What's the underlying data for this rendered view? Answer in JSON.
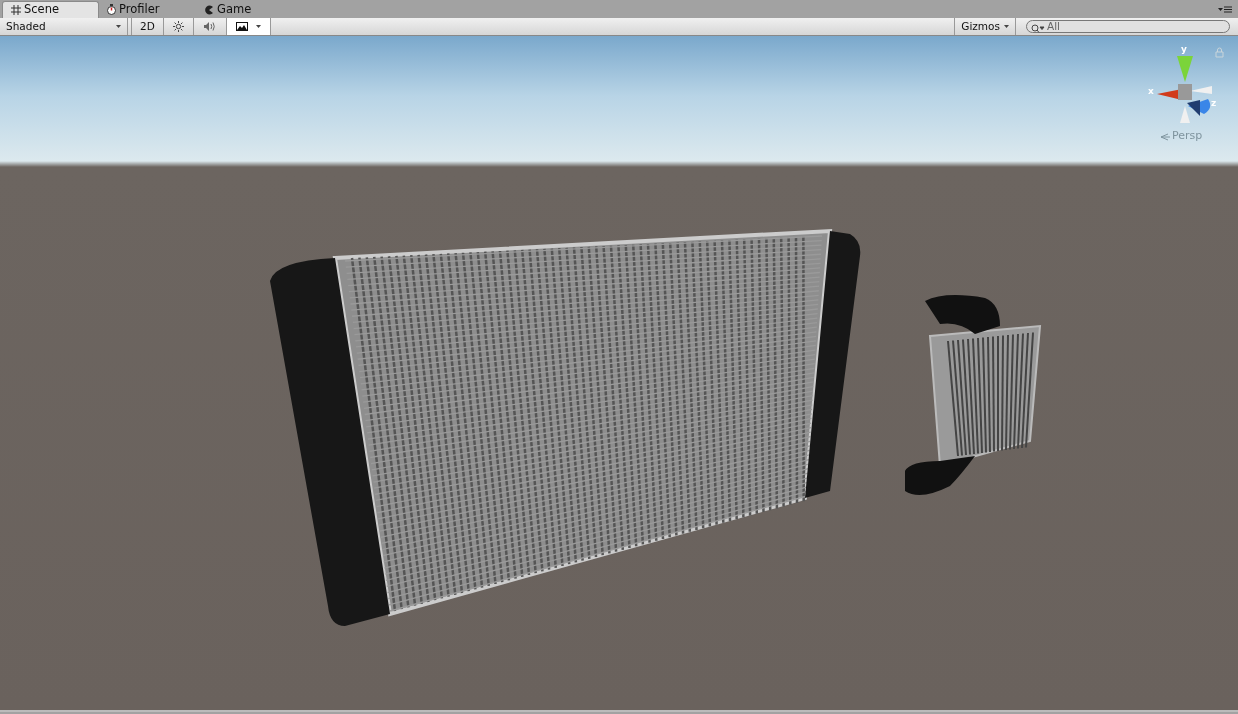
{
  "tabs": [
    {
      "label": "Scene",
      "kind": "grid",
      "selected": true
    },
    {
      "label": "Profiler",
      "kind": "stopwatch",
      "selected": false
    },
    {
      "label": "Game",
      "kind": "pacman",
      "selected": false
    }
  ],
  "toolbar": {
    "draw_mode": "Shaded",
    "toggles": [
      {
        "kind": "text",
        "label": "2D",
        "on": false
      },
      {
        "kind": "sun",
        "on": false
      },
      {
        "kind": "speaker",
        "on": false
      },
      {
        "kind": "image",
        "on": true
      }
    ],
    "gizmos": "Gizmos",
    "search": {
      "placeholder": "All"
    }
  },
  "scene_gizmo": {
    "axes": [
      "y",
      "x",
      "z"
    ],
    "projection": "Persp"
  }
}
